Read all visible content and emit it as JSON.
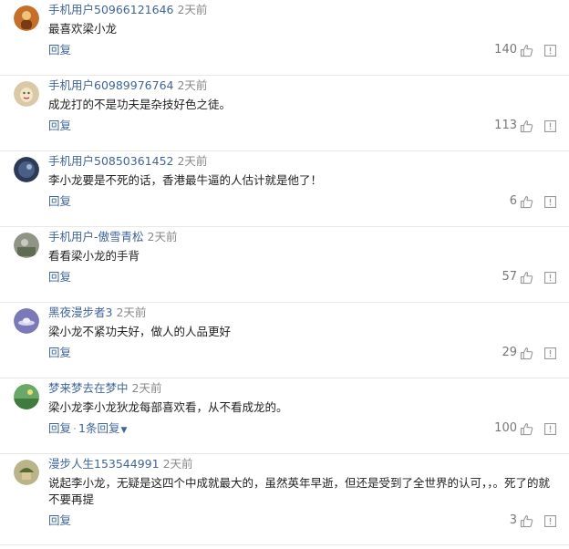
{
  "comments": [
    {
      "user": "手机用户50966121646",
      "time": "2天前",
      "text": "最喜欢梁小龙",
      "reply": "回复",
      "likes": "140",
      "avatar": "avatar-orange-figure"
    },
    {
      "user": "手机用户60989976764",
      "time": "2天前",
      "text": "成龙打的不是功夫是杂技好色之徒。",
      "reply": "回复",
      "likes": "113",
      "avatar": "avatar-beige-cartoon"
    },
    {
      "user": "手机用户50850361452",
      "time": "2天前",
      "text": "李小龙要是不死的话，香港最牛逼的人估计就是他了！",
      "reply": "回复",
      "likes": "6",
      "avatar": "avatar-dark-night"
    },
    {
      "user": "手机用户-傲雪青松",
      "time": "2天前",
      "text": "看看梁小龙的手背",
      "reply": "回复",
      "likes": "57",
      "avatar": "avatar-grey-photo"
    },
    {
      "user": "黑夜漫步者3",
      "time": "2天前",
      "text": "梁小龙不紧功夫好，做人的人品更好",
      "reply": "回复",
      "likes": "29",
      "avatar": "avatar-purple-ufo"
    },
    {
      "user": "梦来梦去在梦中",
      "time": "2天前",
      "text": "梁小龙李小龙狄龙每部喜欢看，从不看成龙的。",
      "reply": "回复",
      "more": "1条回复",
      "likes": "100",
      "avatar": "avatar-green-landscape"
    },
    {
      "user": "漫步人生153544991",
      "time": "2天前",
      "text": "说起李小龙，无疑是这四个中成就最大的，虽然英年早逝，但还是受到了全世界的认可，，。死了的就不要再提",
      "reply": "回复",
      "likes": "3",
      "avatar": "avatar-soldier-helmet"
    }
  ],
  "icons": {
    "like": "thumbs-up-icon",
    "report": "report-icon",
    "expand": "chevron-down-icon"
  },
  "colors": {
    "username": "#406599",
    "time": "#888888",
    "divider": "#e8e8e8",
    "likes": "#777777"
  }
}
